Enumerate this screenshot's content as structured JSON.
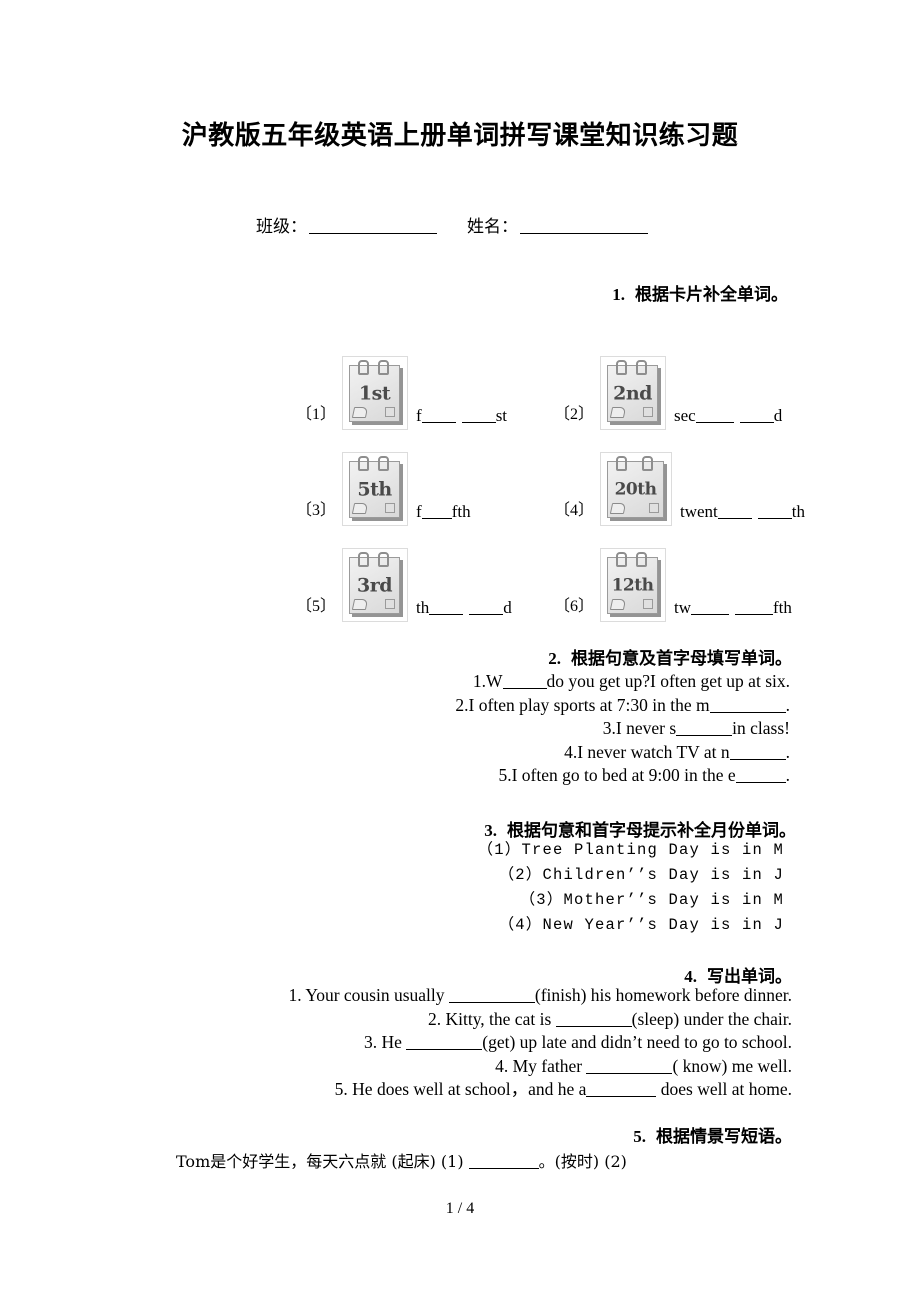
{
  "document": {
    "title": "沪教版五年级英语上册单词拼写课堂知识练习题",
    "page_footer": "1 / 4"
  },
  "id_line": {
    "class_label": "班级：",
    "name_label": "姓名："
  },
  "sections": [
    {
      "number": "1.",
      "heading": "根据卡片补全单词。",
      "items": [
        {
          "no": "〔1〕",
          "card": "1st",
          "prompt_pre": "f",
          "prompt_mid": "",
          "prompt_post": "st"
        },
        {
          "no": "〔2〕",
          "card": "2nd",
          "prompt_pre": "sec",
          "prompt_mid": "",
          "prompt_post": "d"
        },
        {
          "no": "〔3〕",
          "card": "5th",
          "prompt_pre": "f",
          "prompt_mid": "",
          "prompt_post": "fth"
        },
        {
          "no": "〔4〕",
          "card": "20th",
          "prompt_pre": "twent",
          "prompt_mid": "",
          "prompt_post": "th"
        },
        {
          "no": "〔5〕",
          "card": "3rd",
          "prompt_pre": "th",
          "prompt_mid": "",
          "prompt_post": "d"
        },
        {
          "no": "〔6〕",
          "card": "12th",
          "prompt_pre": "tw",
          "prompt_mid": "",
          "prompt_post": "fth"
        }
      ]
    },
    {
      "number": "2.",
      "heading": "根据句意及首字母填写单词。",
      "lines": [
        {
          "pre": "1.W",
          "post": "do you get up?I often get up at six."
        },
        {
          "pre": "2.I often play sports at 7:30 in the m",
          "post": "."
        },
        {
          "pre": "3.I never s",
          "post": "in class!"
        },
        {
          "pre": "4.I never watch TV at n",
          "post": "."
        },
        {
          "pre": "5.I often go to bed at 9:00 in the e",
          "post": "."
        }
      ]
    },
    {
      "number": "3.",
      "heading": "根据句意和首字母提示补全月份单词。",
      "lines": [
        "（1）Tree Planting Day is in M",
        "（2）Children’’s Day is in J",
        "（3）Mother’’s Day is in M",
        "（4）New Year’’s Day is in J"
      ]
    },
    {
      "number": "4.",
      "heading": "写出单词。",
      "lines": [
        {
          "pre": "1. Your cousin usually ",
          "post": "(finish) his homework before dinner."
        },
        {
          "pre": "2. Kitty, the cat is ",
          "post": "(sleep) under the chair."
        },
        {
          "pre": "3. He ",
          "post": "(get) up late and didn’t need to go to school."
        },
        {
          "pre": "4. My father ",
          "post": "( know) me well."
        },
        {
          "pre": "5. He does well at school，and he a",
          "post": " does well at home."
        }
      ]
    },
    {
      "number": "5.",
      "heading": "根据情景写短语。",
      "lines": [
        {
          "pre": "Tom是个好学生，每天六点就 (起床) (1) ",
          "post": "。(按时) (2)"
        }
      ]
    }
  ]
}
